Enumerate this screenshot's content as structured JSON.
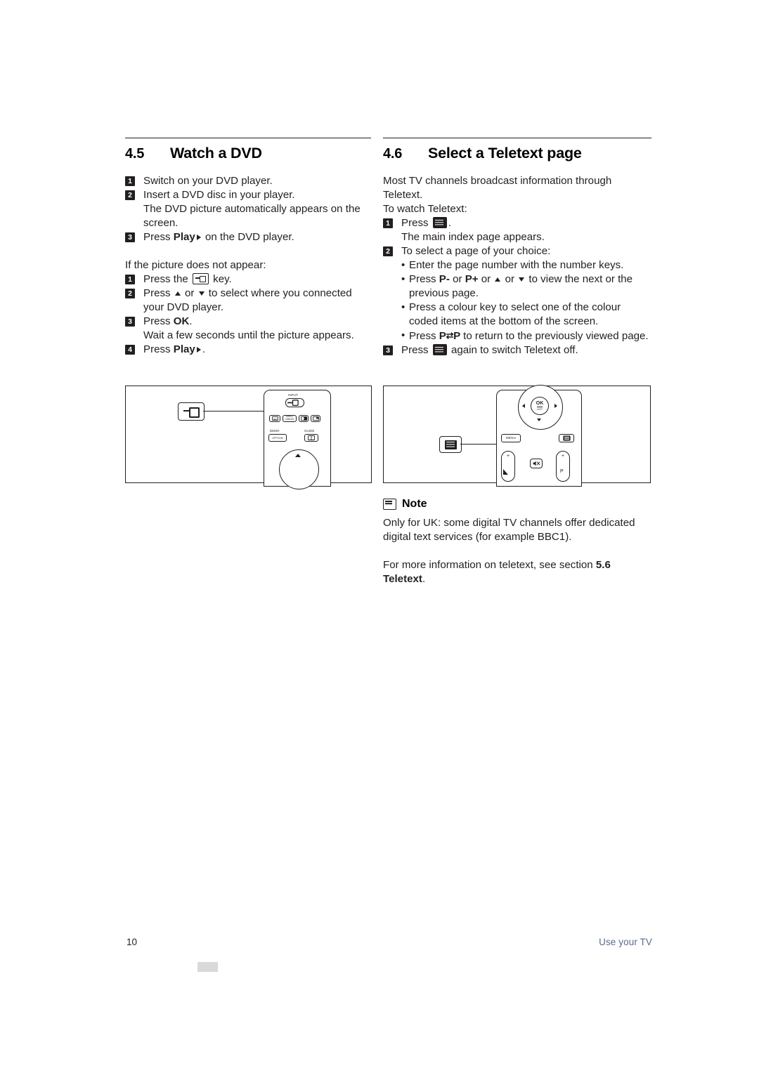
{
  "page": {
    "number": "10",
    "footer_right": "Use your TV"
  },
  "left_section": {
    "number": "4.5",
    "title": "Watch a DVD",
    "steps": [
      {
        "num": "1",
        "text": "Switch on your DVD player."
      },
      {
        "num": "2",
        "text": "Insert a DVD disc in your player."
      },
      {
        "num": "3",
        "text": "Press "
      }
    ],
    "step2_note": "The DVD picture automatically appears on the screen.",
    "step3_pre": "Press ",
    "step3_play": "Play",
    "step3_post": " on the DVD player.",
    "subhead": "If the picture does not appear:",
    "alt_steps": [
      {
        "num": "1",
        "pre": "Press the ",
        "post": " key."
      },
      {
        "num": "2",
        "pre": "Press ",
        "mid1": " or ",
        "mid2": " to select where you connected your DVD player."
      },
      {
        "num": "3",
        "pre": "Press ",
        "bold": "OK",
        "post": "."
      },
      {
        "num": "4",
        "pre": "Press ",
        "bold": "Play",
        "post": "."
      }
    ],
    "alt_step3_note": "Wait a few seconds until the picture appears."
  },
  "right_section": {
    "number": "4.6",
    "title": "Select a Teletext page",
    "intro": "Most TV channels broadcast information through Teletext.",
    "intro2": "To watch Teletext:",
    "step1_pre": "Press ",
    "step1_post": ".",
    "step1_note": "The main index page appears.",
    "step2": "To select a page of your choice:",
    "bullets": [
      {
        "text": "Enter the page number with the number keys."
      },
      {
        "pre": "Press ",
        "b1": "P-",
        "mid": " or ",
        "b2": "P+",
        "mid2": " or ",
        "tail": " to view the next or the previous page."
      },
      {
        "text": "Press a colour key to select one of the colour coded items at the bottom of the screen."
      },
      {
        "pre": "Press ",
        "b1": "P",
        "b2": "P",
        "tail": " to return to the previously viewed page."
      }
    ],
    "step3_pre": "Press ",
    "step3_post": " again to switch Teletext off.",
    "note": {
      "label": "Note",
      "text": "Only for UK: some digital TV channels offer dedicated digital text services (for example BBC1)."
    },
    "more_info_pre": "For more information on teletext, see section ",
    "more_info_section": "5.6",
    "more_info_title": "Teletext",
    "more_info_post": "."
  },
  "figure_left": {
    "name": "remote-control-source-key",
    "keys": {
      "input": "INPUT",
      "mhegcancel1": "MHEG",
      "mhegcancel2": "CANCEL",
      "demo": "DEMO",
      "guide": "GUIDE",
      "option": "OPTION"
    }
  },
  "figure_right": {
    "name": "remote-control-teletext-key",
    "keys": {
      "ok": "OK",
      "list": "LIST",
      "menu": "MENU",
      "plus1": "+",
      "minus1": "–",
      "plus2": "+",
      "p": "P"
    }
  }
}
